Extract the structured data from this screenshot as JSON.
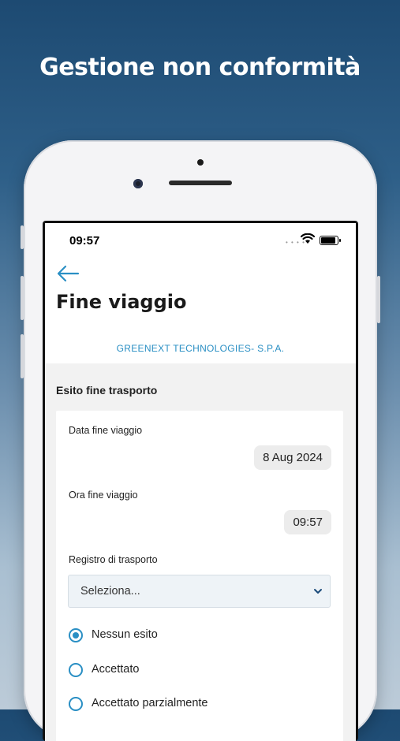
{
  "headline": "Gestione non conformità",
  "status_bar": {
    "time": "09:57"
  },
  "page": {
    "title": "Fine viaggio",
    "company": "GREENEXT TECHNOLOGIES- S.P.A."
  },
  "section": {
    "title": "Esito fine trasporto"
  },
  "form": {
    "date_label": "Data fine viaggio",
    "date_value": "8 Aug 2024",
    "time_label": "Ora fine viaggio",
    "time_value": "09:57",
    "register_label": "Registro di trasporto",
    "register_value": "Seleziona...",
    "options": [
      {
        "label": "Nessun esito",
        "selected": true
      },
      {
        "label": "Accettato",
        "selected": false
      },
      {
        "label": "Accettato parzialmente",
        "selected": false
      }
    ]
  },
  "colors": {
    "accent": "#2a8fc4",
    "background_top": "#1d4a72",
    "background_bottom": "#bccbd8"
  }
}
